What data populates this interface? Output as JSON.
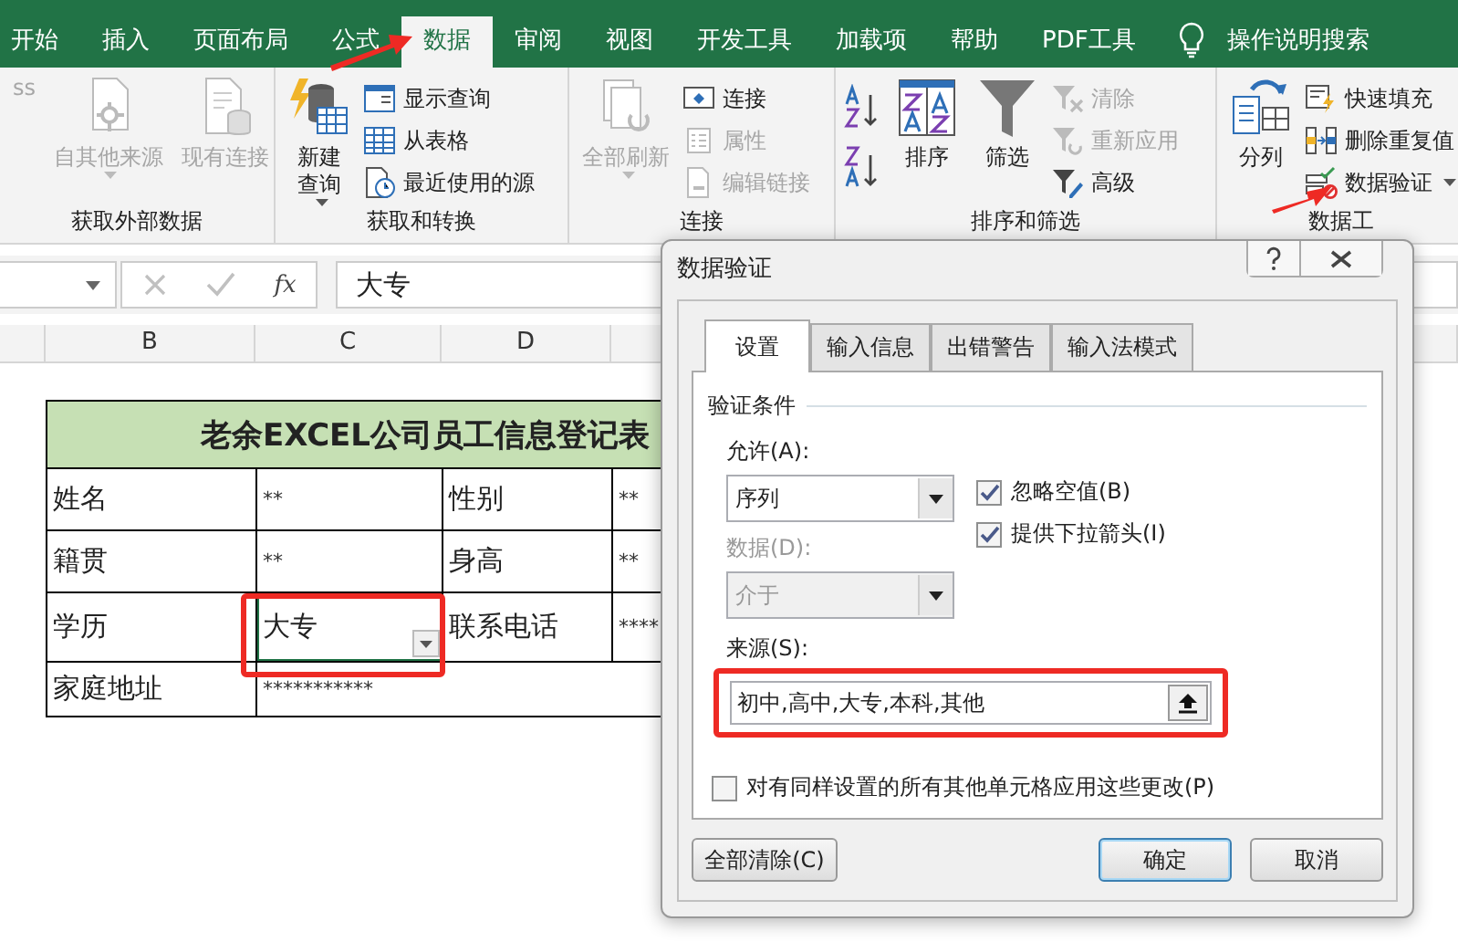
{
  "tabs": [
    {
      "label": "开始",
      "selected": false
    },
    {
      "label": "插入",
      "selected": false
    },
    {
      "label": "页面布局",
      "selected": false
    },
    {
      "label": "公式",
      "selected": false
    },
    {
      "label": "数据",
      "selected": true
    },
    {
      "label": "审阅",
      "selected": false
    },
    {
      "label": "视图",
      "selected": false
    },
    {
      "label": "开发工具",
      "selected": false
    },
    {
      "label": "加载项",
      "selected": false
    },
    {
      "label": "帮助",
      "selected": false
    },
    {
      "label": "PDF工具",
      "selected": false
    }
  ],
  "tell_me": "操作说明搜索",
  "ribbon": {
    "groups": [
      {
        "label": "获取外部数据",
        "items": [
          {
            "kind": "large",
            "label": "ss",
            "disabled": true
          },
          {
            "kind": "large",
            "label": "自其他来源",
            "disabled": true,
            "caret": true
          },
          {
            "kind": "large",
            "label": "现有连接",
            "disabled": true
          }
        ]
      },
      {
        "label": "获取和转换",
        "items": [
          {
            "kind": "large",
            "label_lines": [
              "新建",
              "查询"
            ],
            "disabled": false,
            "caret": true
          },
          {
            "kind": "small",
            "label": "显示查询",
            "disabled": false
          },
          {
            "kind": "small",
            "label": "从表格",
            "disabled": false
          },
          {
            "kind": "small",
            "label": "最近使用的源",
            "disabled": false
          }
        ]
      },
      {
        "label": "连接",
        "items": [
          {
            "kind": "large",
            "label": "全部刷新",
            "disabled": true,
            "caret": true
          },
          {
            "kind": "small",
            "label": "连接",
            "disabled": false
          },
          {
            "kind": "small",
            "label": "属性",
            "disabled": true
          },
          {
            "kind": "small",
            "label": "编辑链接",
            "disabled": true
          }
        ]
      },
      {
        "label": "排序和筛选",
        "items": [
          {
            "kind": "sort-ascending",
            "disabled": false
          },
          {
            "kind": "sort-descending",
            "disabled": false
          },
          {
            "kind": "large",
            "label": "排序",
            "disabled": false
          },
          {
            "kind": "large",
            "label": "筛选",
            "disabled": false
          },
          {
            "kind": "small",
            "label": "清除",
            "disabled": true
          },
          {
            "kind": "small",
            "label": "重新应用",
            "disabled": true
          },
          {
            "kind": "small",
            "label": "高级",
            "disabled": false
          }
        ]
      },
      {
        "label": "数据工",
        "items": [
          {
            "kind": "large",
            "label": "分列",
            "disabled": false
          },
          {
            "kind": "small",
            "label": "快速填充",
            "disabled": false
          },
          {
            "kind": "small",
            "label": "删除重复值",
            "disabled": false
          },
          {
            "kind": "small",
            "label": "数据验证",
            "disabled": false,
            "caret": true
          }
        ]
      }
    ]
  },
  "formula_bar": {
    "function_label": "fx",
    "value": "大专"
  },
  "columns": [
    "B",
    "C",
    "D"
  ],
  "sheet": {
    "title": "老余EXCEL公司员工信息登记表",
    "rows": [
      {
        "cells": [
          {
            "text": "姓名",
            "selected": false
          },
          {
            "text": "**",
            "selected": false
          },
          {
            "text": "性别",
            "selected": false
          },
          {
            "text": "**",
            "selected": false
          }
        ]
      },
      {
        "cells": [
          {
            "text": "籍贯",
            "selected": false
          },
          {
            "text": "**",
            "selected": false
          },
          {
            "text": "身高",
            "selected": false
          },
          {
            "text": "**",
            "selected": false
          }
        ]
      },
      {
        "cells": [
          {
            "text": "学历",
            "selected": false
          },
          {
            "text": "大专",
            "selected": true
          },
          {
            "text": "联系电话",
            "selected": false
          },
          {
            "text": "****",
            "selected": false
          }
        ]
      },
      {
        "cells": [
          {
            "text": "家庭地址",
            "selected": false
          },
          {
            "text": "***********",
            "selected": false
          }
        ]
      }
    ]
  },
  "dialog": {
    "title": "数据验证",
    "tabs": [
      {
        "label": "设置",
        "selected": true
      },
      {
        "label": "输入信息",
        "selected": false
      },
      {
        "label": "出错警告",
        "selected": false
      },
      {
        "label": "输入法模式",
        "selected": false
      }
    ],
    "section": "验证条件",
    "allow": {
      "label": "允许(A):",
      "value": "序列",
      "disabled": false
    },
    "data": {
      "label": "数据(D):",
      "value": "介于",
      "disabled": true
    },
    "checkboxes": [
      {
        "label": "忽略空值(B)",
        "checked": true
      },
      {
        "label": "提供下拉箭头(I)",
        "checked": true
      }
    ],
    "source": {
      "label": "来源(S):",
      "value": "初中,高中,大专,本科,其他"
    },
    "apply_all": {
      "label": "对有同样设置的所有其他单元格应用这些更改(P)",
      "checked": false
    },
    "buttons": [
      {
        "label": "全部清除(C)",
        "default": false
      },
      {
        "label": "确定",
        "default": true
      },
      {
        "label": "取消",
        "default": false
      }
    ]
  }
}
